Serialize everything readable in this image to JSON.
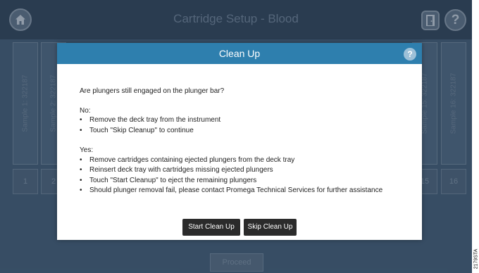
{
  "header": {
    "title": "Cartridge Setup - Blood",
    "help_label": "?"
  },
  "cartridges": {
    "left": [
      {
        "label": "Sample 1: 322187",
        "number": "1"
      },
      {
        "label": "Sample 2: 322187",
        "number": "2"
      }
    ],
    "right": [
      {
        "label": "Sample 15: 322187",
        "number": "15"
      },
      {
        "label": "Sample 16: 322187",
        "number": "16"
      }
    ]
  },
  "footer": {
    "proceed_label": "Proceed"
  },
  "dialog": {
    "title": "Clean Up",
    "help_label": "?",
    "question": "Are plungers still engaged on the plunger bar?",
    "no_heading": "No:",
    "no_items": [
      "Remove the deck tray from the instrument",
      "Touch \"Skip Cleanup\" to continue"
    ],
    "yes_heading": "Yes:",
    "yes_items": [
      "Remove cartridges containing ejected plungers from the deck tray",
      "Reinsert deck tray  with cartridges missing ejected plungers",
      "Touch \"Start Cleanup\" to eject the remaining plungers",
      "Should plunger removal fail, please contact Promega Technical Services for further assistance"
    ],
    "bullet": "•",
    "start_label": "Start Clean Up",
    "skip_label": "Skip Clean Up"
  },
  "figure_code": "2179STA",
  "colors": {
    "dialog_header": "#2e7fae",
    "screen_background": "#3f5a74",
    "button_dark": "#2b2b2b"
  }
}
